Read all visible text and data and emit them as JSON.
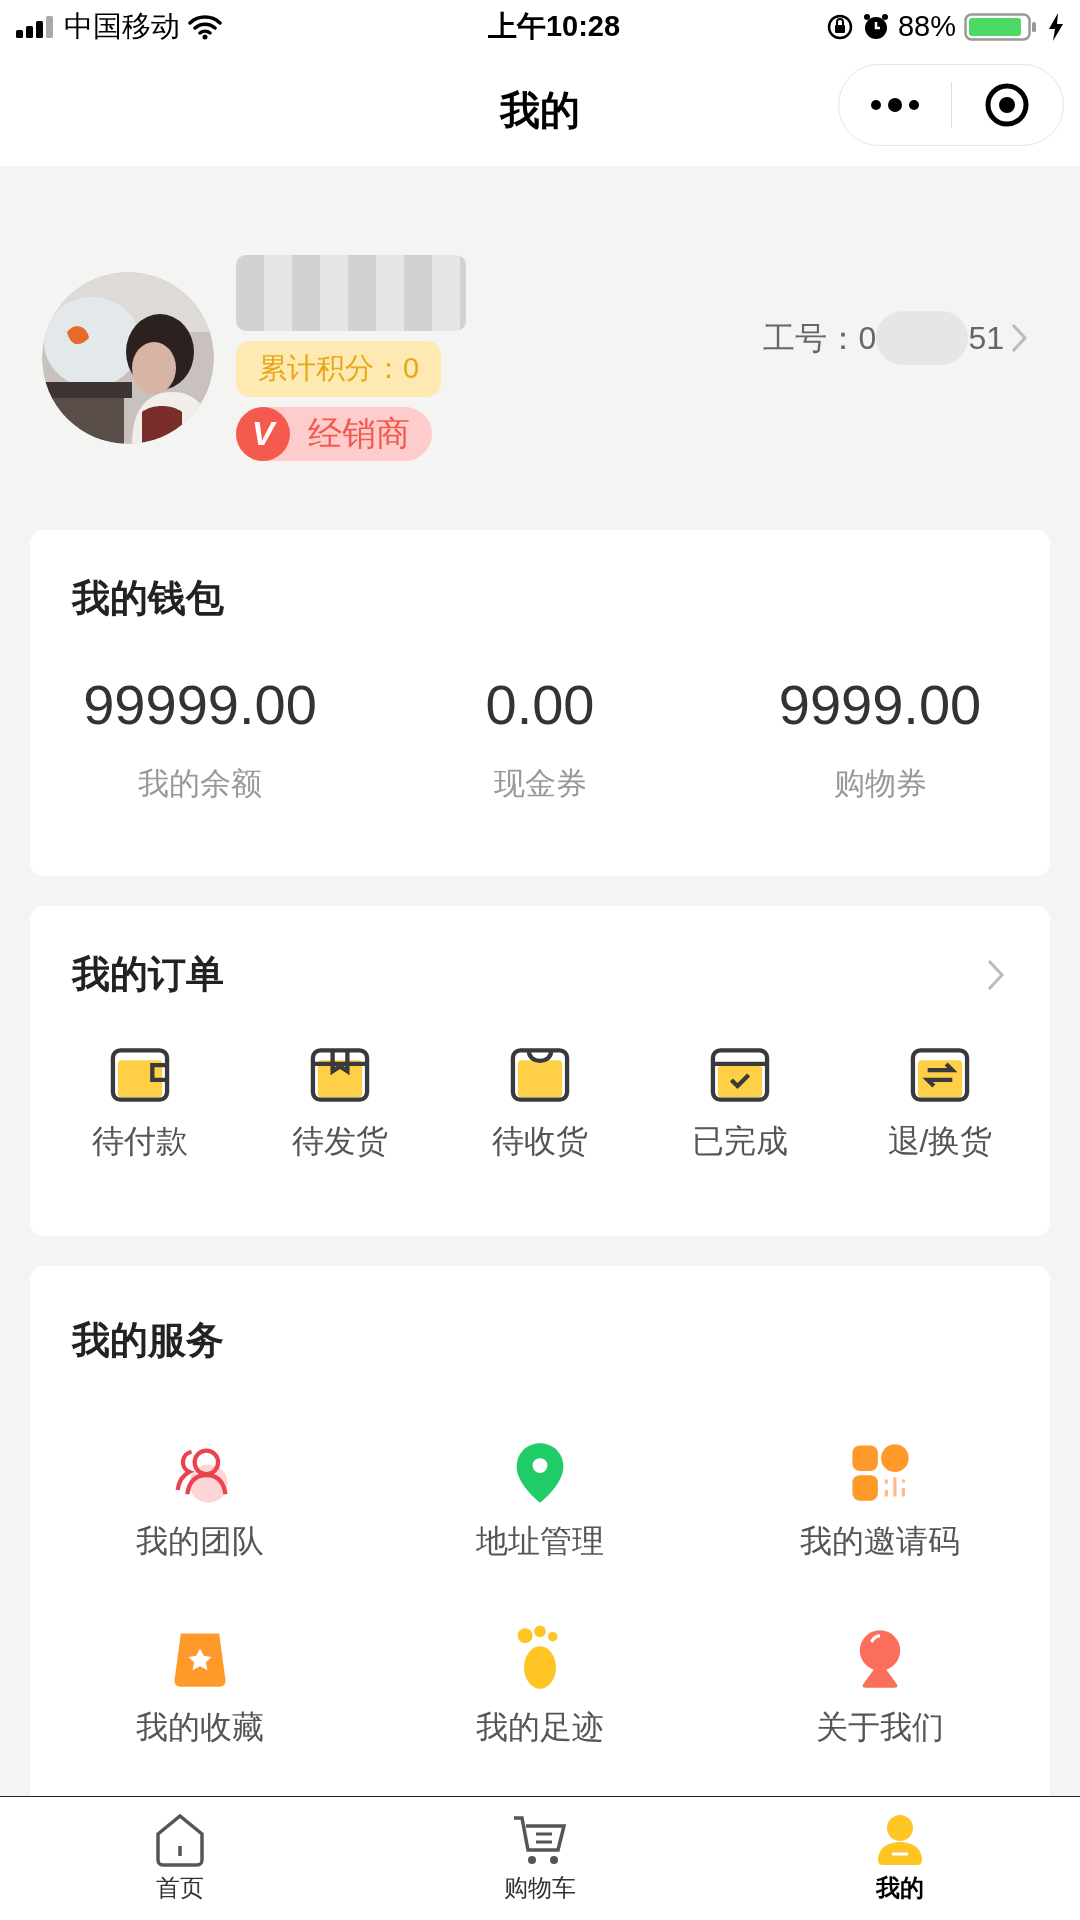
{
  "status_bar": {
    "carrier": "中国移动",
    "time": "上午10:28",
    "battery": "88%"
  },
  "nav": {
    "title": "我的"
  },
  "profile": {
    "points": "累计积分：0",
    "role": "经销商",
    "role_icon": "V",
    "id_label": "工号：0",
    "id_tail": "51"
  },
  "wallet": {
    "title": "我的钱包",
    "items": [
      {
        "value": "99999.00",
        "label": "我的余额"
      },
      {
        "value": "0.00",
        "label": "现金券"
      },
      {
        "value": "9999.00",
        "label": "购物券"
      }
    ]
  },
  "orders": {
    "title": "我的订单",
    "items": [
      "待付款",
      "待发货",
      "待收货",
      "已完成",
      "退/换货"
    ]
  },
  "services": {
    "title": "我的服务",
    "items": [
      "我的团队",
      "地址管理",
      "我的邀请码",
      "我的收藏",
      "我的足迹",
      "关于我们"
    ]
  },
  "tab_bar": [
    {
      "label": "首页",
      "selected": false
    },
    {
      "label": "购物车",
      "selected": false
    },
    {
      "label": "我的",
      "selected": true
    }
  ]
}
